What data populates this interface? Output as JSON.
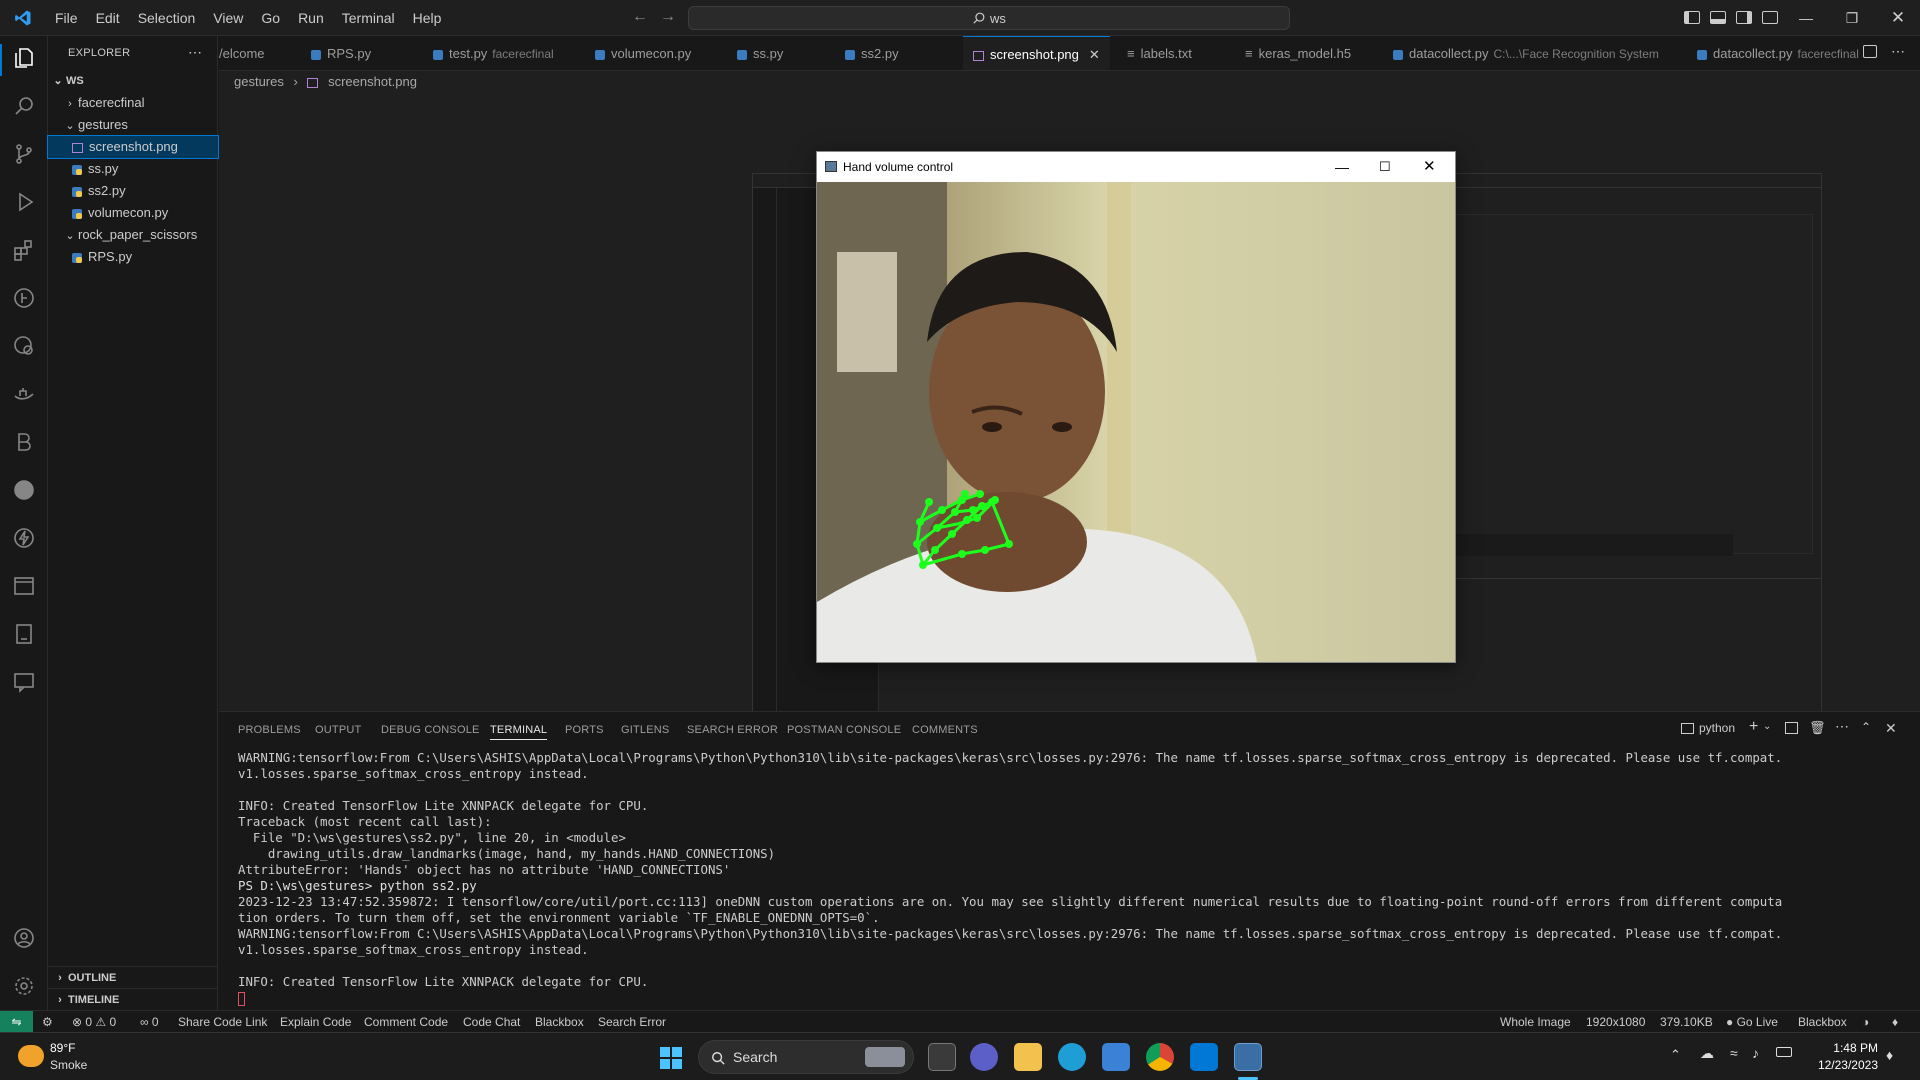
{
  "titlebar": {
    "menu": [
      "File",
      "Edit",
      "Selection",
      "View",
      "Go",
      "Run",
      "Terminal",
      "Help"
    ],
    "search": "ws"
  },
  "sidebar": {
    "title": "EXPLORER",
    "workspace": "WS",
    "items": [
      {
        "label": "facerecfinal",
        "type": "folder",
        "expanded": false
      },
      {
        "label": "gestures",
        "type": "folder",
        "expanded": true
      },
      {
        "label": "screenshot.png",
        "type": "image",
        "selected": true
      },
      {
        "label": "ss.py",
        "type": "py"
      },
      {
        "label": "ss2.py",
        "type": "py"
      },
      {
        "label": "volumecon.py",
        "type": "py"
      },
      {
        "label": "rock_paper_scissors",
        "type": "folder",
        "expanded": true
      },
      {
        "label": "RPS.py",
        "type": "py"
      }
    ],
    "outline": "OUTLINE",
    "timeline": "TIMELINE"
  },
  "tabs": [
    {
      "label": "/elcome",
      "desc": ""
    },
    {
      "label": "RPS.py",
      "desc": ""
    },
    {
      "label": "test.py",
      "desc": "facerecfinal"
    },
    {
      "label": "volumecon.py",
      "desc": ""
    },
    {
      "label": "ss.py",
      "desc": ""
    },
    {
      "label": "ss2.py",
      "desc": ""
    },
    {
      "label": "screenshot.png",
      "desc": "",
      "active": true
    },
    {
      "label": "labels.txt",
      "desc": ""
    },
    {
      "label": "keras_model.h5",
      "desc": ""
    },
    {
      "label": "datacollect.py",
      "desc": "C:\\...\\Face Recognition System"
    },
    {
      "label": "datacollect.py",
      "desc": "facerecfinal"
    }
  ],
  "breadcrumb": [
    "gestures",
    "screenshot.png"
  ],
  "cv_window": {
    "title": "Hand volume control"
  },
  "panel": {
    "tabs": [
      "PROBLEMS",
      "OUTPUT",
      "DEBUG CONSOLE",
      "TERMINAL",
      "PORTS",
      "GITLENS",
      "SEARCH ERROR",
      "POSTMAN CONSOLE",
      "COMMENTS"
    ],
    "active_tab": "TERMINAL",
    "shell": "python",
    "terminal_lines": [
      "WARNING:tensorflow:From C:\\Users\\ASHIS\\AppData\\Local\\Programs\\Python\\Python310\\lib\\site-packages\\keras\\src\\losses.py:2976: The name tf.losses.sparse_softmax_cross_entropy is deprecated. Please use tf.compat.",
      "v1.losses.sparse_softmax_cross_entropy instead.",
      "",
      "INFO: Created TensorFlow Lite XNNPACK delegate for CPU.",
      "Traceback (most recent call last):",
      "  File \"D:\\ws\\gestures\\ss2.py\", line 20, in <module>",
      "    drawing_utils.draw_landmarks(image, hand, my_hands.HAND_CONNECTIONS)",
      "AttributeError: 'Hands' object has no attribute 'HAND_CONNECTIONS'",
      "PS D:\\ws\\gestures> python ss2.py",
      "2023-12-23 13:47:52.359872: I tensorflow/core/util/port.cc:113] oneDNN custom operations are on. You may see slightly different numerical results due to floating-point round-off errors from different computa",
      "tion orders. To turn them off, set the environment variable `TF_ENABLE_ONEDNN_OPTS=0`.",
      "WARNING:tensorflow:From C:\\Users\\ASHIS\\AppData\\Local\\Programs\\Python\\Python310\\lib\\site-packages\\keras\\src\\losses.py:2976: The name tf.losses.sparse_softmax_cross_entropy is deprecated. Please use tf.compat.",
      "v1.losses.sparse_softmax_cross_entropy instead.",
      "",
      "INFO: Created TensorFlow Lite XNNPACK delegate for CPU."
    ]
  },
  "statusbar": {
    "errors": "0",
    "warnings": "0",
    "ports": "0",
    "left_items": [
      "Share Code Link",
      "Explain Code",
      "Comment Code",
      "Code Chat",
      "Blackbox",
      "Search Error"
    ],
    "right_items": [
      "Whole Image",
      "1920x1080",
      "379.10KB",
      "Go Live",
      "Blackbox"
    ]
  },
  "taskbar": {
    "weather_temp": "89°F",
    "weather_desc": "Smoke",
    "search": "Search",
    "time": "1:48 PM",
    "date": "12/23/2023"
  },
  "colors": {
    "accent": "#0078d4",
    "landmark": "#1cff1c",
    "remote": "#16825d"
  }
}
